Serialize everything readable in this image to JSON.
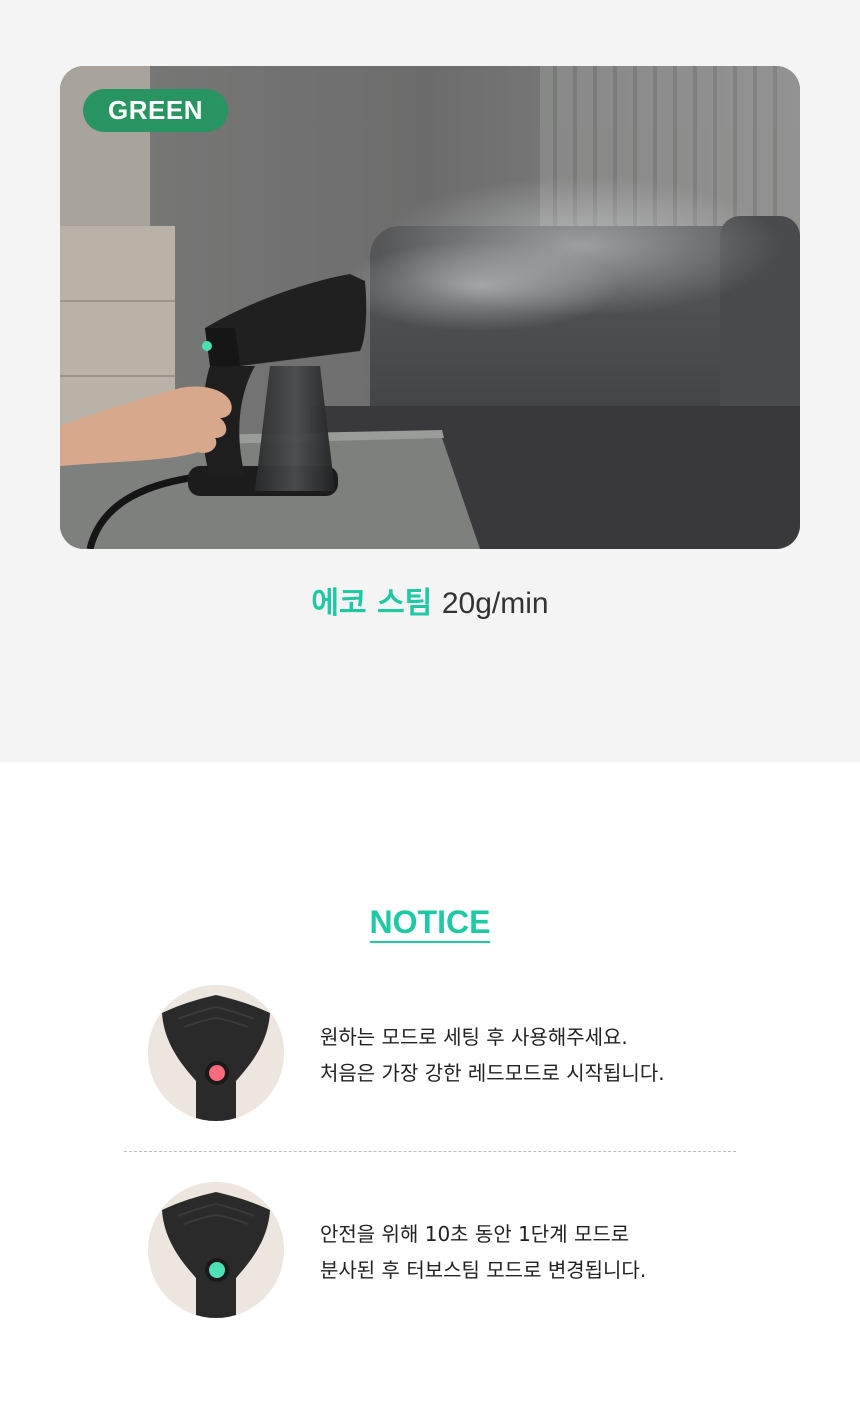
{
  "hero": {
    "badge": "GREEN",
    "badge_color": "#279461",
    "photo_icon": "garment-steamer-photo"
  },
  "caption": {
    "accent_text": "에코 스팀",
    "spec_text": "20g/min",
    "accent_color": "#1ec9a3"
  },
  "notice": {
    "title": "NOTICE",
    "items": [
      {
        "lines": [
          "원하는 모드로 세팅 후 사용해주세요.",
          "처음은 가장 강한 레드모드로 시작됩니다."
        ],
        "indicator_color": "#ff6b7a",
        "thumb_icon": "steamer-red-mode-icon"
      },
      {
        "lines": [
          "안전을 위해 10초 동안 1단계 모드로",
          "분사된 후 터보스팀 모드로 변경됩니다."
        ],
        "indicator_color": "#4fe0b8",
        "thumb_icon": "steamer-green-mode-icon"
      }
    ]
  }
}
